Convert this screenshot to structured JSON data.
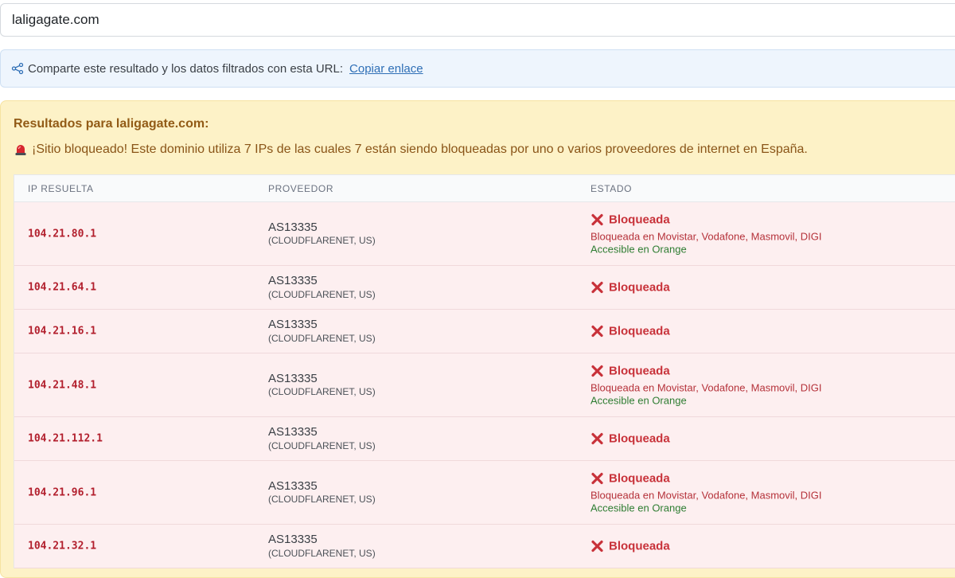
{
  "search": {
    "value": "laligagate.com"
  },
  "share": {
    "text": "Comparte este resultado y los datos filtrados con esta URL:",
    "link_label": "Copiar enlace",
    "icon": "share-icon"
  },
  "results": {
    "title": "Resultados para laligagate.com:",
    "alert_icon": "siren-icon",
    "alert_text": "¡Sitio bloqueado! Este dominio utiliza 7 IPs de las cuales 7 están siendo bloqueadas por uno o varios proveedores de internet en España."
  },
  "table": {
    "headers": {
      "ip": "IP RESUELTA",
      "provider": "PROVEEDOR",
      "state": "ESTADO"
    },
    "rows": [
      {
        "ip": "104.21.80.1",
        "asn": "AS13335",
        "org": "(CLOUDFLARENET, US)",
        "status": "Bloqueada",
        "blocked_in": "Bloqueada en Movistar, Vodafone, Masmovil, DIGI",
        "accessible_in": "Accesible en Orange"
      },
      {
        "ip": "104.21.64.1",
        "asn": "AS13335",
        "org": "(CLOUDFLARENET, US)",
        "status": "Bloqueada"
      },
      {
        "ip": "104.21.16.1",
        "asn": "AS13335",
        "org": "(CLOUDFLARENET, US)",
        "status": "Bloqueada"
      },
      {
        "ip": "104.21.48.1",
        "asn": "AS13335",
        "org": "(CLOUDFLARENET, US)",
        "status": "Bloqueada",
        "blocked_in": "Bloqueada en Movistar, Vodafone, Masmovil, DIGI",
        "accessible_in": "Accesible en Orange"
      },
      {
        "ip": "104.21.112.1",
        "asn": "AS13335",
        "org": "(CLOUDFLARENET, US)",
        "status": "Bloqueada"
      },
      {
        "ip": "104.21.96.1",
        "asn": "AS13335",
        "org": "(CLOUDFLARENET, US)",
        "status": "Bloqueada",
        "blocked_in": "Bloqueada en Movistar, Vodafone, Masmovil, DIGI",
        "accessible_in": "Accesible en Orange"
      },
      {
        "ip": "104.21.32.1",
        "asn": "AS13335",
        "org": "(CLOUDFLARENET, US)",
        "status": "Bloqueada"
      }
    ]
  },
  "colors": {
    "blocked": "#c8323a",
    "accessible": "#2e7d32",
    "warning_bg": "#fdf2c7",
    "row_bg": "#fdeff0",
    "link": "#2f6fb6"
  }
}
